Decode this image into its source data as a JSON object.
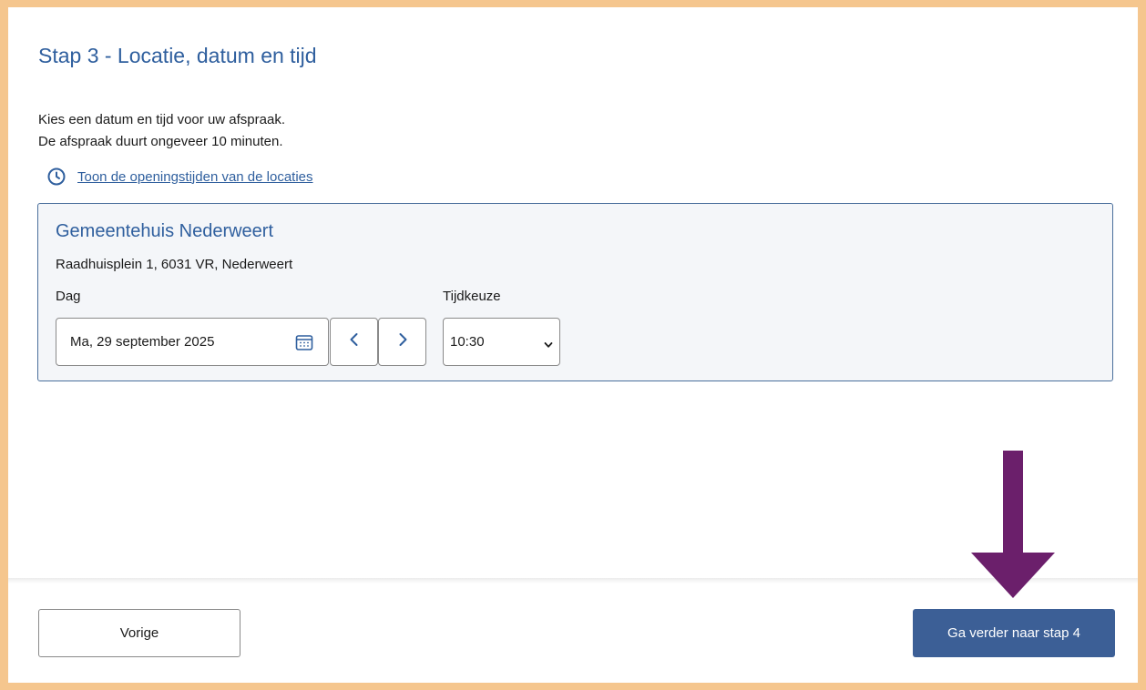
{
  "page": {
    "title": "Stap 3 - Locatie, datum en tijd",
    "intro_line1": "Kies een datum en tijd voor uw afspraak.",
    "intro_line2": "De afspraak duurt ongeveer 10 minuten.",
    "hours_link": "Toon de openingstijden van de locaties"
  },
  "location": {
    "name": "Gemeentehuis Nederweert",
    "address": "Raadhuisplein 1, 6031 VR, Nederweert",
    "day_label": "Dag",
    "date_value": "Ma, 29 september 2025",
    "time_label": "Tijdkeuze",
    "time_value": "10:30"
  },
  "footer": {
    "prev_label": "Vorige",
    "next_label": "Ga verder naar stap 4"
  },
  "colors": {
    "accent": "#2f5f9e",
    "primary_button": "#3c5f96",
    "frame_border": "#f5c68e",
    "annotation_arrow": "#6b1f6b"
  },
  "icons": {
    "hours_link": "clock-icon",
    "date_field": "calendar-icon",
    "prev_day": "chevron-left-icon",
    "next_day": "chevron-right-icon",
    "time_select": "chevron-down-icon",
    "annotation": "arrow-down-icon"
  }
}
